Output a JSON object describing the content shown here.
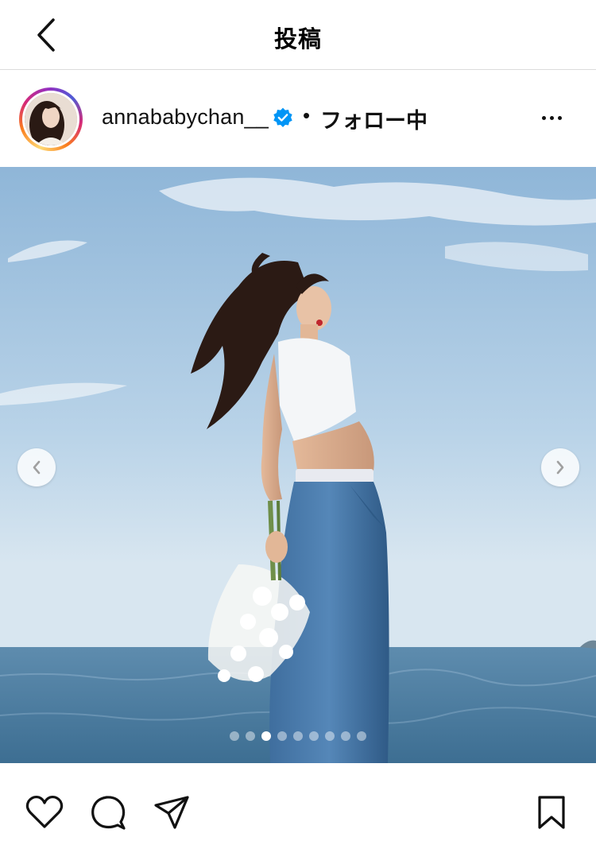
{
  "header": {
    "title": "投稿"
  },
  "post": {
    "username": "annababychan__",
    "separator": "•",
    "follow_status": "フォロー中",
    "verified": true,
    "carousel": {
      "total_slides": 9,
      "active_index": 2
    }
  },
  "colors": {
    "verified_blue": "#0095f6",
    "divider": "#dbdbdb"
  },
  "icons": [
    "back-arrow-icon",
    "verified-badge-icon",
    "more-options-icon",
    "chevron-left-icon",
    "chevron-right-icon",
    "heart-icon",
    "comment-icon",
    "share-icon",
    "bookmark-icon"
  ]
}
